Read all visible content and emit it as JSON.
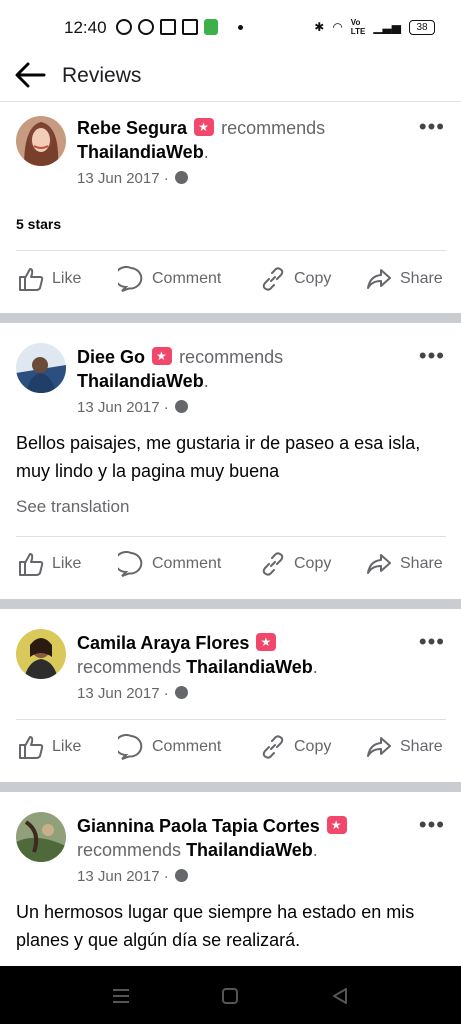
{
  "status_bar": {
    "time": "12:40",
    "battery": "38"
  },
  "header": {
    "title": "Reviews"
  },
  "reviews": [
    {
      "name": "Rebe Segura",
      "recommends": "recommends",
      "page": "ThailandiaWeb",
      "date": "13 Jun 2017",
      "rating": "5 stars",
      "actions": {
        "like": "Like",
        "comment": "Comment",
        "copy": "Copy",
        "share": "Share"
      }
    },
    {
      "name": "Diee Go",
      "recommends": "recommends",
      "page": "ThailandiaWeb",
      "date": "13 Jun 2017",
      "text": "Bellos paisajes, me gustaria ir de paseo a esa isla, muy lindo y la pagina muy buena",
      "see_translation": "See translation",
      "actions": {
        "like": "Like",
        "comment": "Comment",
        "copy": "Copy",
        "share": "Share"
      }
    },
    {
      "name": "Camila Araya Flores",
      "recommends": "recommends",
      "page": "ThailandiaWeb",
      "date": "13 Jun 2017",
      "actions": {
        "like": "Like",
        "comment": "Comment",
        "copy": "Copy",
        "share": "Share"
      }
    },
    {
      "name": "Giannina Paola Tapia Cortes",
      "recommends": "recommends",
      "page": "ThailandiaWeb",
      "date": "13 Jun 2017",
      "text": "Un hermosos lugar que siempre ha estado en mis planes y que algún día se realizará."
    }
  ],
  "colors": {
    "accent_badge": "#f2476c",
    "secondary_text": "#65676b",
    "separator": "#c9ccd1"
  }
}
